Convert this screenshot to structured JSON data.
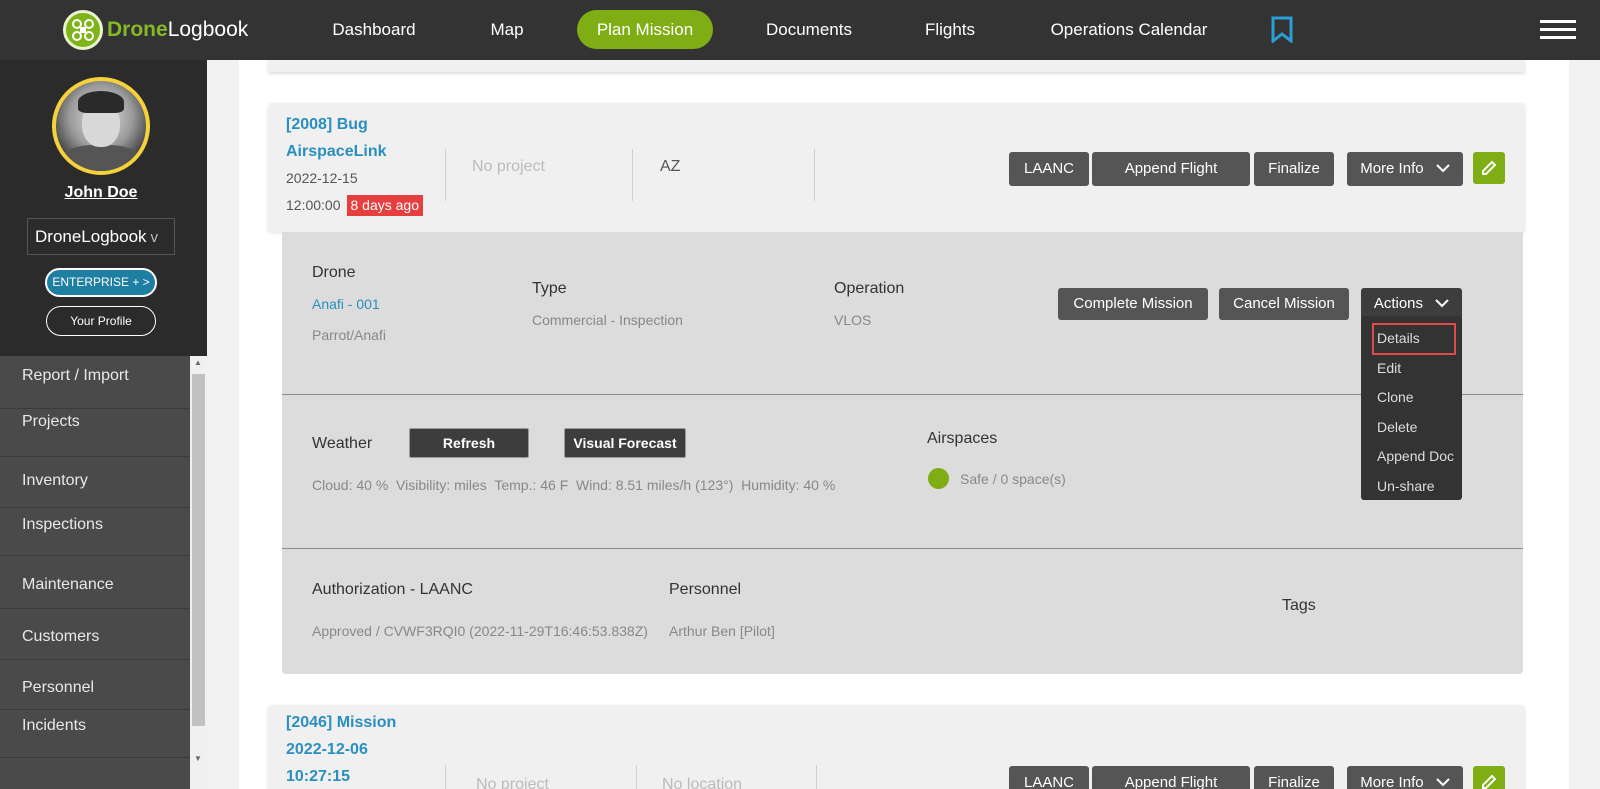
{
  "brand": {
    "part1": "Drone",
    "part2": "Logbook",
    "logo_icon": "drone-logo-icon"
  },
  "nav": {
    "items": [
      "Dashboard",
      "Map",
      "Plan Mission",
      "Documents",
      "Flights",
      "Operations Calendar"
    ],
    "active": "Plan Mission",
    "active_color": "#7fad14",
    "bookmark_icon": "bookmark-icon",
    "menu_icon": "hamburger-menu-icon"
  },
  "sidebar": {
    "user_name": "John Doe",
    "org": "DroneLogbook",
    "org_chevron": "v",
    "enterprise_label": "ENTERPRISE + >",
    "profile_label": "Your Profile",
    "menu": [
      "Report / Import",
      "Projects",
      "Inventory",
      "Inspections",
      "Maintenance",
      "Customers",
      "Personnel",
      "Incidents"
    ]
  },
  "mission1": {
    "title_line1": "[2008] Bug",
    "title_line2": "AirspaceLink",
    "date": "2022-12-15",
    "time": "12:00:00",
    "ago": "8 days ago",
    "project": "No project",
    "location": "AZ",
    "buttons": {
      "laanc": "LAANC",
      "append": "Append Flight",
      "finalize": "Finalize",
      "more": "More Info"
    }
  },
  "details": {
    "drone_label": "Drone",
    "drone_name": "Anafi - 001",
    "drone_model": "Parrot/Anafi",
    "type_label": "Type",
    "type_value": "Commercial - Inspection",
    "operation_label": "Operation",
    "operation_value": "VLOS",
    "complete_btn": "Complete Mission",
    "cancel_btn": "Cancel Mission",
    "actions_btn": "Actions",
    "weather_label": "Weather",
    "refresh_btn": "Refresh",
    "forecast_btn": "Visual Forecast",
    "weather_text": "Cloud: 40 %  Visibility: miles  Temp.: 46 F  Wind: 8.51 miles/h (123°)  Humidity: 40 %",
    "airspaces_label": "Airspaces",
    "airspaces_value": "Safe / 0 space(s)",
    "auth_label": "Authorization - LAANC",
    "auth_value": "Approved / CVWF3RQI0 (2022-11-29T16:46:53.838Z)",
    "personnel_label": "Personnel",
    "personnel_value": "Arthur Ben [Pilot]",
    "tags_label": "Tags"
  },
  "actions_menu": [
    "Details",
    "Edit",
    "Clone",
    "Delete",
    "Append Doc",
    "Un-share"
  ],
  "mission2": {
    "title_line1": "[2046] Mission",
    "title_line2": "2022-12-06",
    "title_line3": "10:27:15",
    "project": "No project",
    "location": "No location",
    "buttons": {
      "laanc": "LAANC",
      "append": "Append Flight",
      "finalize": "Finalize",
      "more": "More Info"
    }
  }
}
